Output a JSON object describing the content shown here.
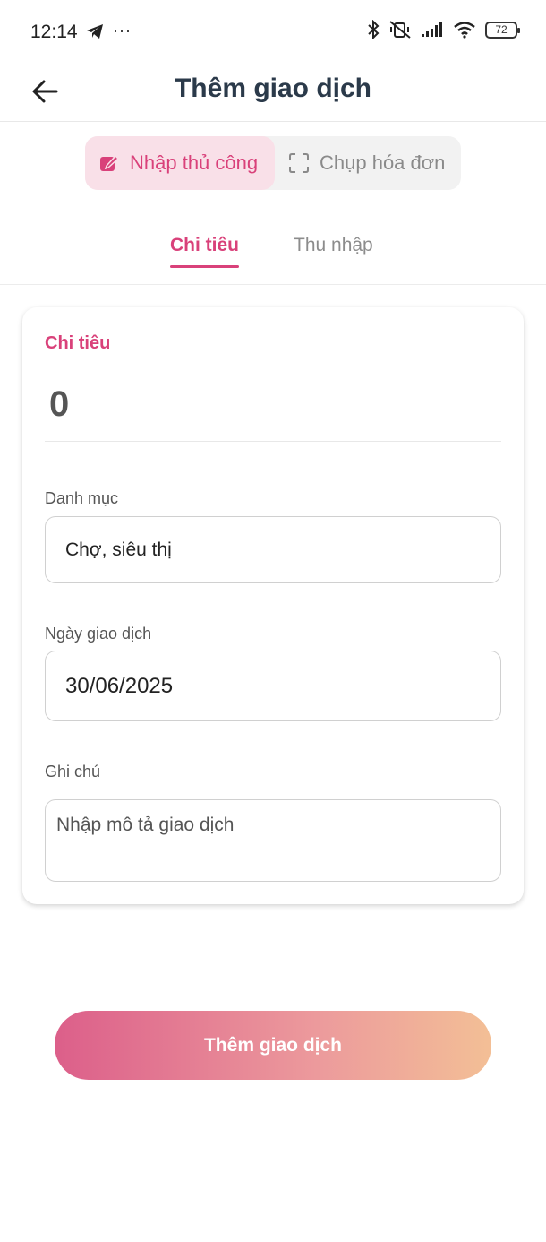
{
  "status_bar": {
    "time": "12:14",
    "dots": "···",
    "battery": "72"
  },
  "header": {
    "title": "Thêm giao dịch",
    "back_icon": "arrow-left-icon"
  },
  "mode_switch": {
    "manual_label": "Nhập thủ công",
    "scan_label": "Chụp hóa đơn",
    "selected": "manual"
  },
  "type_tabs": {
    "expense_label": "Chi tiêu",
    "income_label": "Thu nhập",
    "selected": "expense"
  },
  "form": {
    "section_title": "Chi tiêu",
    "amount": "0",
    "category_label": "Danh mục",
    "category_value": "Chợ, siêu thị",
    "date_label": "Ngày giao dịch",
    "date_value": "30/06/2025",
    "note_label": "Ghi chú",
    "note_placeholder": "Nhập mô tả giao dịch"
  },
  "submit": {
    "label": "Thêm giao dịch"
  },
  "colors": {
    "accent": "#d9417a",
    "title": "#2b3a4a",
    "gradient_start": "#dc5f8a",
    "gradient_end": "#f3bf96"
  }
}
